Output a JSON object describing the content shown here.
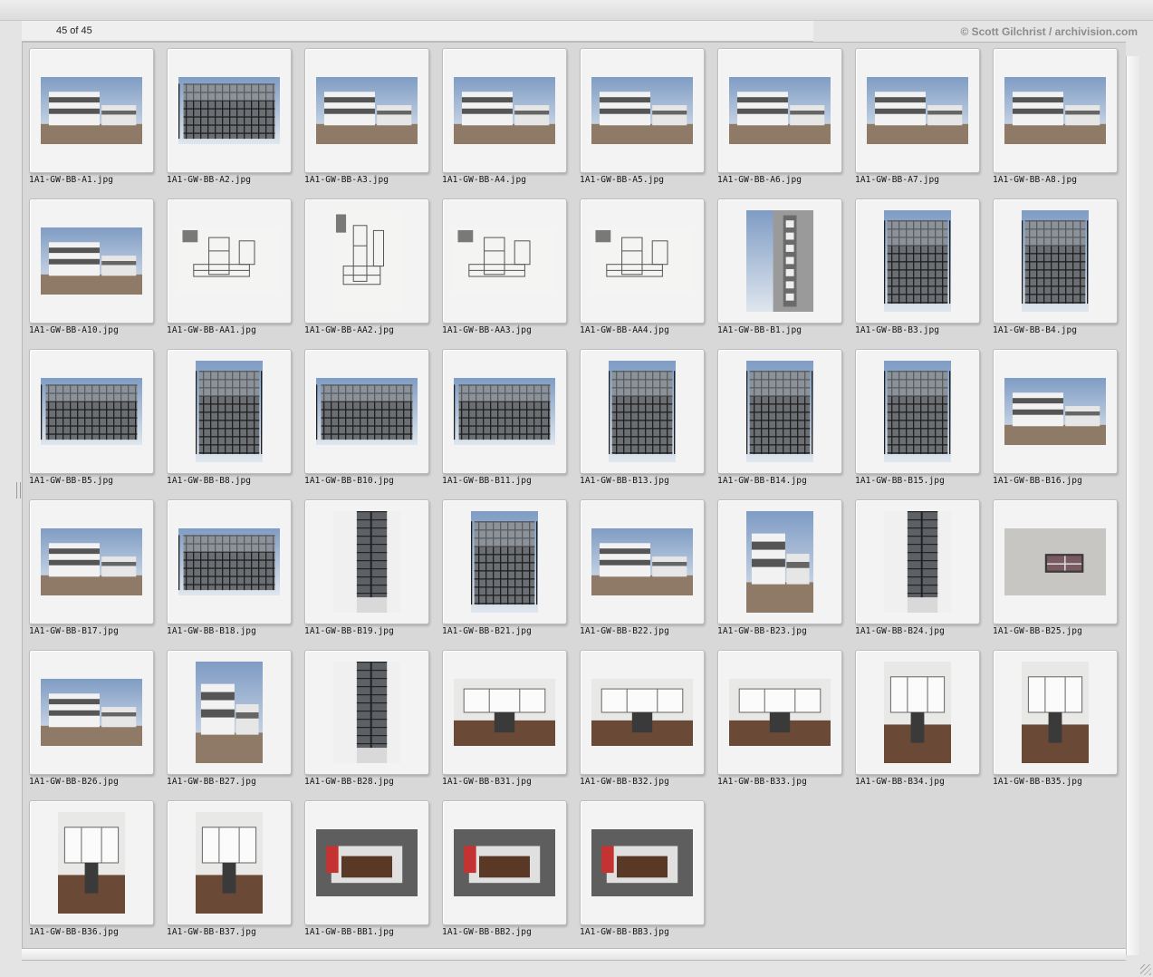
{
  "header": {
    "count": "45 of 45",
    "credit": "© Scott Gilchrist / archivision.com"
  },
  "items": [
    {
      "file": "1A1-GW-BB-A1.jpg",
      "kind": "ext",
      "orient": "l"
    },
    {
      "file": "1A1-GW-BB-A2.jpg",
      "kind": "glass",
      "orient": "l"
    },
    {
      "file": "1A1-GW-BB-A3.jpg",
      "kind": "ext",
      "orient": "l"
    },
    {
      "file": "1A1-GW-BB-A4.jpg",
      "kind": "ext",
      "orient": "l"
    },
    {
      "file": "1A1-GW-BB-A5.jpg",
      "kind": "ext",
      "orient": "l"
    },
    {
      "file": "1A1-GW-BB-A6.jpg",
      "kind": "ext",
      "orient": "l"
    },
    {
      "file": "1A1-GW-BB-A7.jpg",
      "kind": "ext",
      "orient": "l"
    },
    {
      "file": "1A1-GW-BB-A8.jpg",
      "kind": "ext",
      "orient": "l"
    },
    {
      "file": "1A1-GW-BB-A10.jpg",
      "kind": "ext",
      "orient": "l"
    },
    {
      "file": "1A1-GW-BB-AA1.jpg",
      "kind": "plan",
      "orient": "l"
    },
    {
      "file": "1A1-GW-BB-AA2.jpg",
      "kind": "plan",
      "orient": "p"
    },
    {
      "file": "1A1-GW-BB-AA3.jpg",
      "kind": "plan",
      "orient": "l"
    },
    {
      "file": "1A1-GW-BB-AA4.jpg",
      "kind": "plan",
      "orient": "l"
    },
    {
      "file": "1A1-GW-BB-B1.jpg",
      "kind": "sign",
      "orient": "p"
    },
    {
      "file": "1A1-GW-BB-B3.jpg",
      "kind": "glass",
      "orient": "p"
    },
    {
      "file": "1A1-GW-BB-B4.jpg",
      "kind": "glass",
      "orient": "p"
    },
    {
      "file": "1A1-GW-BB-B5.jpg",
      "kind": "glass",
      "orient": "l"
    },
    {
      "file": "1A1-GW-BB-B8.jpg",
      "kind": "glass",
      "orient": "p"
    },
    {
      "file": "1A1-GW-BB-B10.jpg",
      "kind": "glass",
      "orient": "l"
    },
    {
      "file": "1A1-GW-BB-B11.jpg",
      "kind": "glass",
      "orient": "l"
    },
    {
      "file": "1A1-GW-BB-B13.jpg",
      "kind": "glass",
      "orient": "p"
    },
    {
      "file": "1A1-GW-BB-B14.jpg",
      "kind": "glass",
      "orient": "p"
    },
    {
      "file": "1A1-GW-BB-B15.jpg",
      "kind": "glass",
      "orient": "p"
    },
    {
      "file": "1A1-GW-BB-B16.jpg",
      "kind": "ext",
      "orient": "l"
    },
    {
      "file": "1A1-GW-BB-B17.jpg",
      "kind": "ext",
      "orient": "l"
    },
    {
      "file": "1A1-GW-BB-B18.jpg",
      "kind": "glass",
      "orient": "l"
    },
    {
      "file": "1A1-GW-BB-B19.jpg",
      "kind": "corner",
      "orient": "p"
    },
    {
      "file": "1A1-GW-BB-B21.jpg",
      "kind": "glass",
      "orient": "p"
    },
    {
      "file": "1A1-GW-BB-B22.jpg",
      "kind": "ext",
      "orient": "l"
    },
    {
      "file": "1A1-GW-BB-B23.jpg",
      "kind": "ext",
      "orient": "p"
    },
    {
      "file": "1A1-GW-BB-B24.jpg",
      "kind": "corner",
      "orient": "p"
    },
    {
      "file": "1A1-GW-BB-B25.jpg",
      "kind": "wall",
      "orient": "l"
    },
    {
      "file": "1A1-GW-BB-B26.jpg",
      "kind": "ext",
      "orient": "l"
    },
    {
      "file": "1A1-GW-BB-B27.jpg",
      "kind": "ext",
      "orient": "p"
    },
    {
      "file": "1A1-GW-BB-B28.jpg",
      "kind": "corner",
      "orient": "p"
    },
    {
      "file": "1A1-GW-BB-B31.jpg",
      "kind": "int",
      "orient": "l"
    },
    {
      "file": "1A1-GW-BB-B32.jpg",
      "kind": "int",
      "orient": "l"
    },
    {
      "file": "1A1-GW-BB-B33.jpg",
      "kind": "int",
      "orient": "l"
    },
    {
      "file": "1A1-GW-BB-B34.jpg",
      "kind": "int",
      "orient": "p"
    },
    {
      "file": "1A1-GW-BB-B35.jpg",
      "kind": "int",
      "orient": "p"
    },
    {
      "file": "1A1-GW-BB-B36.jpg",
      "kind": "int",
      "orient": "p"
    },
    {
      "file": "1A1-GW-BB-B37.jpg",
      "kind": "int",
      "orient": "p"
    },
    {
      "file": "1A1-GW-BB-BB1.jpg",
      "kind": "model",
      "orient": "l"
    },
    {
      "file": "1A1-GW-BB-BB2.jpg",
      "kind": "model",
      "orient": "l"
    },
    {
      "file": "1A1-GW-BB-BB3.jpg",
      "kind": "model",
      "orient": "l"
    }
  ]
}
